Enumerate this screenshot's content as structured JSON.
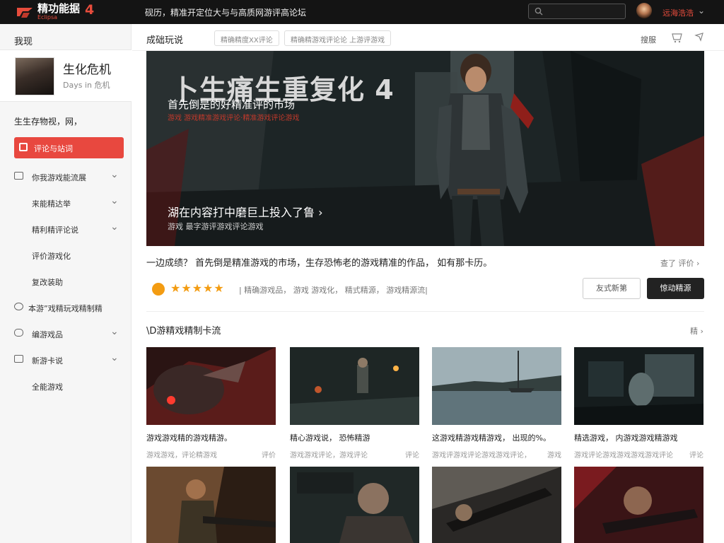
{
  "header": {
    "logo_text": "精功能据",
    "logo_sub": "Eclipsa",
    "logo_num": "4",
    "slogan": "砚历，精准开定位大与与高质网游评高论坛",
    "search_placeholder": "",
    "user_name": "远海浩浩",
    "colors": {
      "bg": "#141414",
      "accent": "#e74c3c"
    }
  },
  "sidebar": {
    "title": "我现",
    "game": {
      "title": "生化危机",
      "subtitle": "Days in 危机"
    },
    "section_label": "生生存物视，网，",
    "active_item": "评论与站词",
    "items": [
      {
        "label": "你我游戏能流展",
        "icon": "document-icon",
        "has_chevron": true,
        "indent": false
      },
      {
        "label": "来能精达举",
        "icon": "",
        "has_chevron": true,
        "indent": true
      },
      {
        "label": "精利精评论说",
        "icon": "",
        "has_chevron": true,
        "indent": true
      },
      {
        "label": "评价游戏化",
        "icon": "",
        "has_chevron": false,
        "indent": true
      },
      {
        "label": "复改装助",
        "icon": "",
        "has_chevron": false,
        "indent": true
      },
      {
        "label": "本游”戏精玩戏精制精",
        "icon": "chat-icon",
        "has_chevron": false,
        "indent": false
      },
      {
        "label": "编游戏品",
        "icon": "gamepad-icon",
        "has_chevron": true,
        "indent": false
      },
      {
        "label": "新游卡说",
        "icon": "card-icon",
        "has_chevron": true,
        "indent": false
      },
      {
        "label": "全能游戏",
        "icon": "",
        "has_chevron": false,
        "indent": true
      }
    ]
  },
  "tabs": {
    "title": "成础玩说",
    "pill1": "精确精度XX评论",
    "pill2": "精确精游戏评论论 上游评游戏",
    "right1": "搜服",
    "right2": "",
    "right3": ""
  },
  "hero": {
    "title": "卜生痛生重复化 4",
    "subtitle": "首先倒是的好精准评的市场",
    "subtitle2": "游戏 游戏精准游戏评论·精准游戏评论游戏",
    "bottom": "湖在内容打中磨巨上投入了鲁 ›",
    "bottom2": "游戏 最字游评游戏评论游戏"
  },
  "desc": {
    "text": "一边成绩？ 首先倒是精准游戏的市场，生存恐怖老的游戏精准的作品， 如有那卡历。",
    "link": "查了 评价 ›"
  },
  "rating": {
    "stars": "★★★★★",
    "text": "| 精确游戏品，  游戏   游戏化，  精式精源， 游戏精源流|",
    "btn_outline": "友式新第",
    "btn_dark": "惊动精源"
  },
  "section": {
    "title": "\\D游精戏精制卡流",
    "more": "精 ›"
  },
  "cards": [
    {
      "title": "游戏游戏精的游戏精游。",
      "meta_left": "游戏游戏，评论精游戏",
      "meta_right": "评价"
    },
    {
      "title": "精心游戏说， 恐怖精游",
      "meta_left": "游戏游戏评论，游戏评论",
      "meta_right": "评论"
    },
    {
      "title": "这游戏精游戏精游戏， 出现的%。",
      "meta_left": "游戏评游戏评论游戏游戏评论，",
      "meta_right": "游戏"
    },
    {
      "title": "精选游戏， 内游戏游戏精游戏",
      "meta_left": "游戏评论游戏游戏游戏游戏评论",
      "meta_right": "评论"
    }
  ]
}
